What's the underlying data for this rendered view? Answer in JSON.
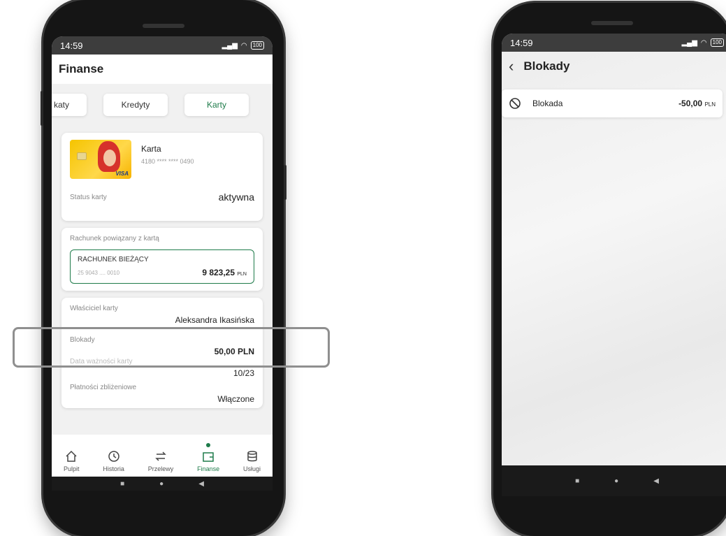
{
  "status": {
    "time": "14:59",
    "battery": "100"
  },
  "left": {
    "title": "Finanse",
    "tabs": [
      {
        "label": "katy"
      },
      {
        "label": "Kredyty"
      },
      {
        "label": "Karty"
      }
    ],
    "card": {
      "name": "Karta",
      "number": "4180 **** **** 0490",
      "status_label": "Status karty",
      "status_value": "aktywna",
      "visa": "VISA"
    },
    "account": {
      "label": "Rachunek powiązany z kartą",
      "name": "RACHUNEK BIEŻĄCY",
      "number": "25 9043 .... 0010",
      "balance": "9 823,25",
      "currency": "PLN"
    },
    "details": {
      "owner_label": "Właściciel karty",
      "owner_value": "Aleksandra Ikasińska",
      "blocks_label": "Blokady",
      "blocks_value": "50,00 PLN",
      "expiry_label": "Data ważności karty",
      "expiry_value": "10/23",
      "contactless_label": "Płatności zbliżeniowe",
      "contactless_value": "Włączone"
    },
    "nav": [
      {
        "label": "Pulpit",
        "icon": "home-icon"
      },
      {
        "label": "Historia",
        "icon": "history-icon"
      },
      {
        "label": "Przelewy",
        "icon": "transfer-icon"
      },
      {
        "label": "Finanse",
        "icon": "wallet-icon"
      },
      {
        "label": "Usługi",
        "icon": "services-icon"
      }
    ]
  },
  "right": {
    "title": "Blokady",
    "item": {
      "label": "Blokada",
      "amount": "-50,00",
      "currency": "PLN"
    }
  },
  "colors": {
    "accent": "#1e7b4a",
    "highlight": "#8f8f8f"
  }
}
